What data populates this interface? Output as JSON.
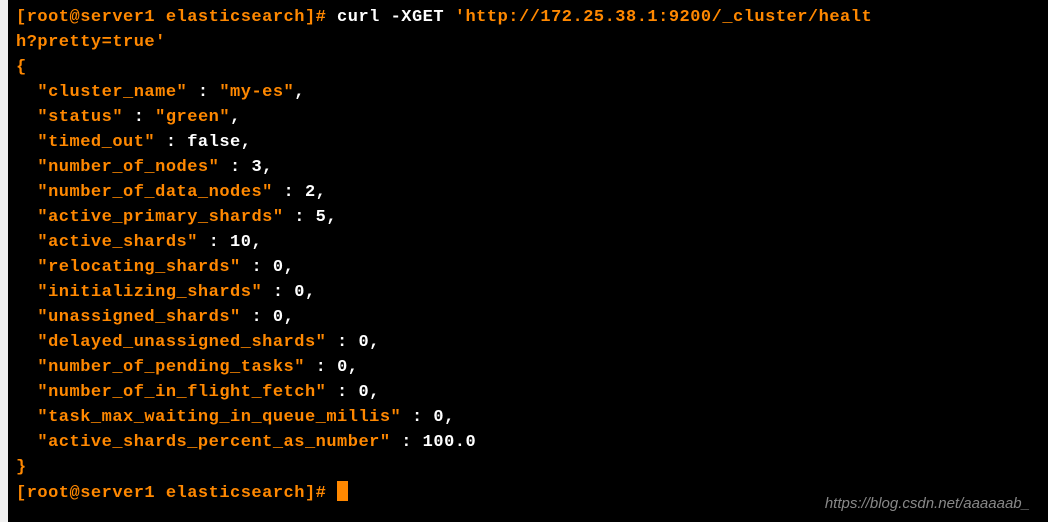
{
  "prompt1_user": "[root@server1 elasticsearch]#",
  "cmd_verb": " curl -XGET ",
  "cmd_url_line1": "'http://172.25.38.1:9200/_cluster/healt",
  "cmd_url_line2": "h?pretty=true'",
  "brace_open": "{",
  "brace_close": "}",
  "prompt2_user": "[root@server1 elasticsearch]#",
  "indent": "  ",
  "fields": [
    {
      "key": "\"cluster_name\"",
      "val": "\"my-es\"",
      "cls": "str",
      "comma": ","
    },
    {
      "key": "\"status\"",
      "val": "\"green\"",
      "cls": "str",
      "comma": ","
    },
    {
      "key": "\"timed_out\"",
      "val": "false",
      "cls": "bool",
      "comma": ","
    },
    {
      "key": "\"number_of_nodes\"",
      "val": "3",
      "cls": "num",
      "comma": ","
    },
    {
      "key": "\"number_of_data_nodes\"",
      "val": "2",
      "cls": "num",
      "comma": ","
    },
    {
      "key": "\"active_primary_shards\"",
      "val": "5",
      "cls": "num",
      "comma": ","
    },
    {
      "key": "\"active_shards\"",
      "val": "10",
      "cls": "num",
      "comma": ","
    },
    {
      "key": "\"relocating_shards\"",
      "val": "0",
      "cls": "num",
      "comma": ","
    },
    {
      "key": "\"initializing_shards\"",
      "val": "0",
      "cls": "num",
      "comma": ","
    },
    {
      "key": "\"unassigned_shards\"",
      "val": "0",
      "cls": "num",
      "comma": ","
    },
    {
      "key": "\"delayed_unassigned_shards\"",
      "val": "0",
      "cls": "num",
      "comma": ","
    },
    {
      "key": "\"number_of_pending_tasks\"",
      "val": "0",
      "cls": "num",
      "comma": ","
    },
    {
      "key": "\"number_of_in_flight_fetch\"",
      "val": "0",
      "cls": "num",
      "comma": ","
    },
    {
      "key": "\"task_max_waiting_in_queue_millis\"",
      "val": "0",
      "cls": "num",
      "comma": ","
    },
    {
      "key": "\"active_shards_percent_as_number\"",
      "val": "100.0",
      "cls": "num",
      "comma": ""
    }
  ],
  "watermark": "https://blog.csdn.net/aaaaaab_"
}
